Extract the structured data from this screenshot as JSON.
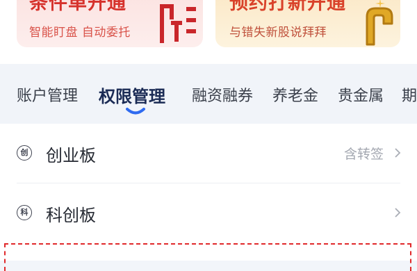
{
  "banners": [
    {
      "title": "条件单开通",
      "subtitle": "智能盯盘 自动委托",
      "art_icon": "chart-icon"
    },
    {
      "title": "预约打新开通",
      "subtitle": "与错失新股说拜拜",
      "art_icon": "hand-pointer-icon"
    }
  ],
  "tabs": [
    {
      "label": "账户管理",
      "active": false
    },
    {
      "label": "权限管理",
      "active": true
    },
    {
      "label": "融资融券",
      "active": false
    },
    {
      "label": "养老金",
      "active": false
    },
    {
      "label": "贵金属",
      "active": false
    },
    {
      "label": "期",
      "active": false
    }
  ],
  "list": [
    {
      "badge": "创",
      "label": "创业板",
      "tag": "含转签"
    },
    {
      "badge": "科",
      "label": "科创板",
      "tag": ""
    }
  ],
  "colors": {
    "accent_red": "#e0292b",
    "active_tab": "#1b2b55",
    "indicator_blue": "#2f6bf0"
  }
}
